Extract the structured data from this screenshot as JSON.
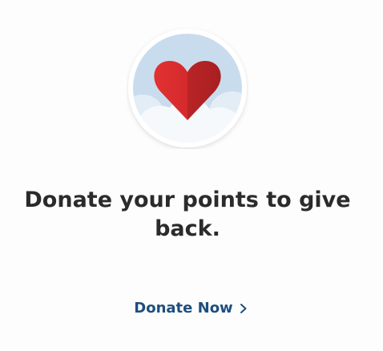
{
  "promo": {
    "image": {
      "icon": "heart-in-clouds",
      "sky_color": "#c9dced",
      "cloud_color": "#f6f9fc",
      "heart_color": "#d8282c",
      "ring_color": "#ffffff"
    },
    "headline": "Donate your points to give back.",
    "cta": {
      "label": "Donate Now",
      "icon": "chevron-right-icon",
      "color": "#1d4f7e"
    }
  }
}
